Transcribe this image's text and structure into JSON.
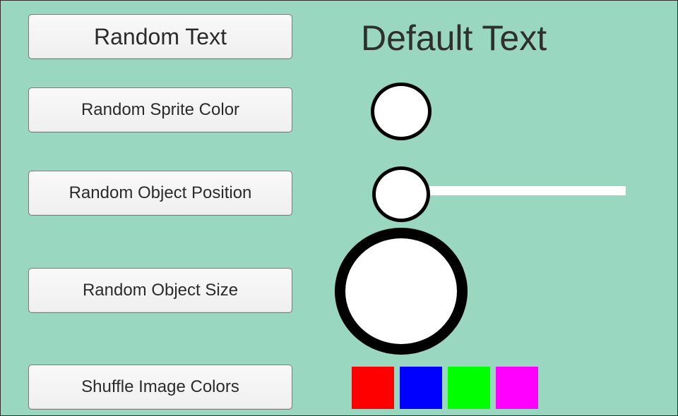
{
  "buttons": {
    "random_text": "Random Text",
    "random_sprite_color": "Random Sprite Color",
    "random_object_position": "Random Object Position",
    "random_object_size": "Random Object Size",
    "shuffle_image_colors": "Shuffle Image Colors"
  },
  "display_text": "Default Text",
  "colors": {
    "background": "#99d7c0",
    "sprite_fill": "#ffffff",
    "sprite_outline": "#000000",
    "trail": "#ffffff"
  },
  "swatches": [
    {
      "name": "red",
      "color": "#ff0000"
    },
    {
      "name": "blue",
      "color": "#0000ff"
    },
    {
      "name": "green",
      "color": "#00ff00"
    },
    {
      "name": "magenta",
      "color": "#ff00ff"
    }
  ]
}
